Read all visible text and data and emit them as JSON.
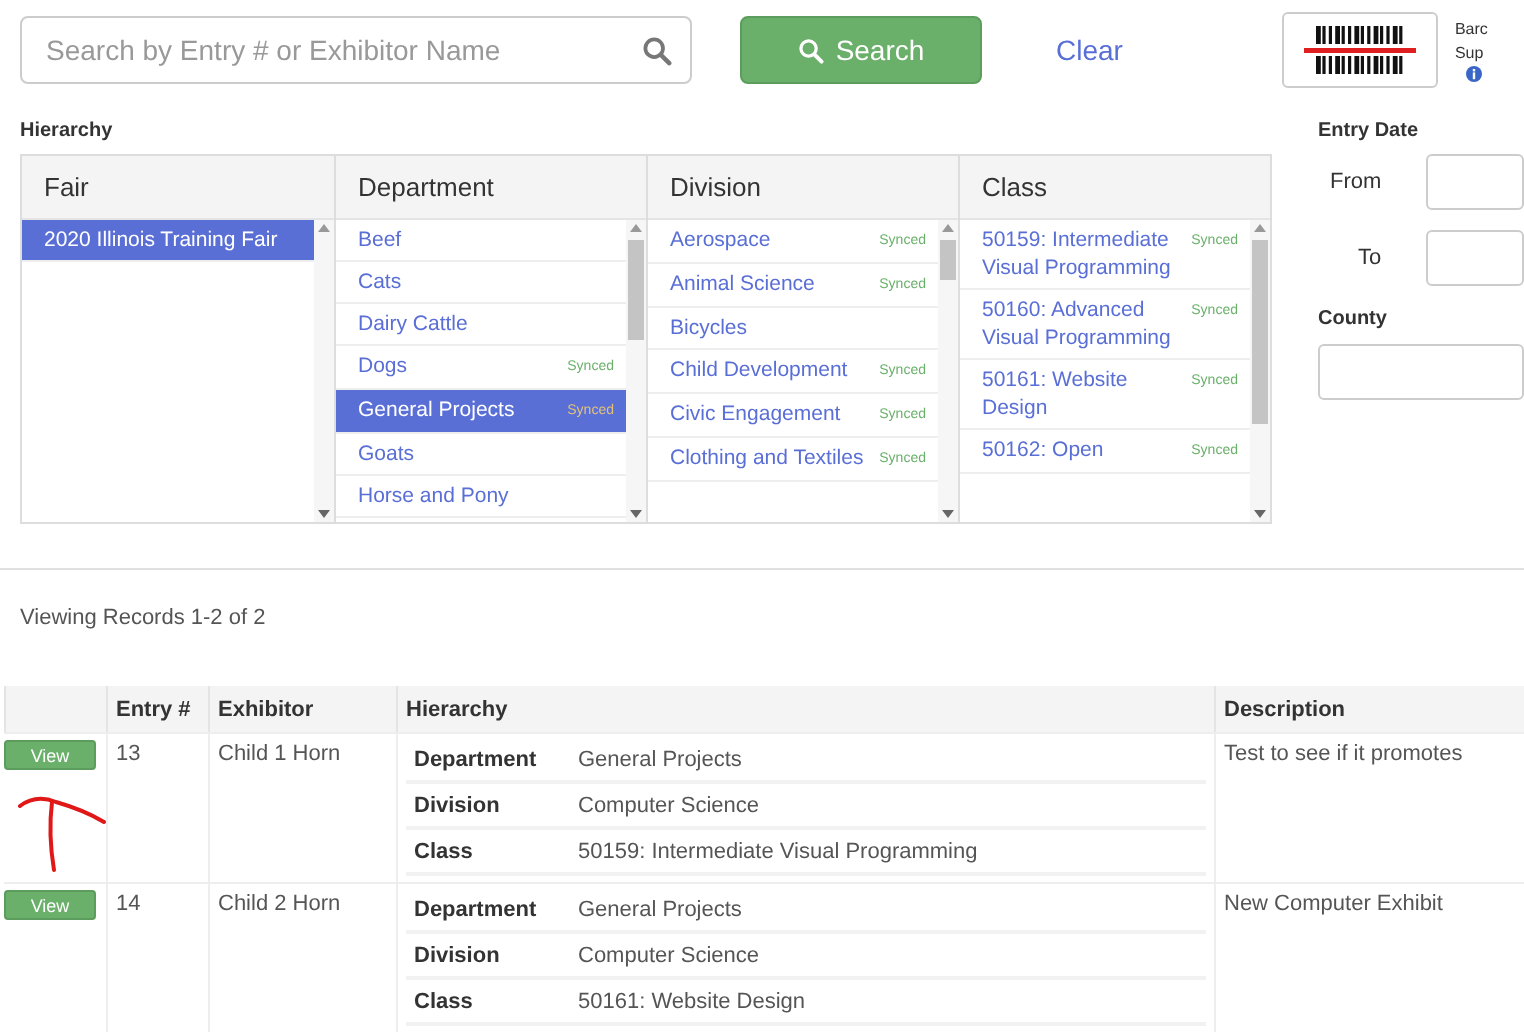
{
  "search": {
    "placeholder": "Search by Entry # or Exhibitor Name",
    "button": "Search",
    "clear": "Clear"
  },
  "barcode": {
    "lines": [
      "Barc",
      "Sup"
    ]
  },
  "hierarchy": {
    "label": "Hierarchy",
    "columns": [
      {
        "title": "Fair",
        "items": [
          {
            "label": "2020 Illinois Training Fair",
            "selected": true
          }
        ]
      },
      {
        "title": "Department",
        "items": [
          {
            "label": "Beef",
            "selected": false
          },
          {
            "label": "Cats",
            "selected": false
          },
          {
            "label": "Dairy Cattle",
            "selected": false
          },
          {
            "label": "Dogs",
            "badge": "Synced",
            "selected": false
          },
          {
            "label": "General Projects",
            "badge": "Synced",
            "selected": true
          },
          {
            "label": "Goats",
            "selected": false
          },
          {
            "label": "Horse and Pony",
            "selected": false
          }
        ]
      },
      {
        "title": "Division",
        "items": [
          {
            "label": "Aerospace",
            "badge": "Synced",
            "selected": false
          },
          {
            "label": "Animal Science",
            "badge": "Synced",
            "selected": false
          },
          {
            "label": "Bicycles",
            "selected": false
          },
          {
            "label": "Child Development",
            "badge": "Synced",
            "selected": false
          },
          {
            "label": "Civic Engagement",
            "badge": "Synced",
            "selected": false
          },
          {
            "label": "Clothing and Textiles",
            "badge": "Synced",
            "selected": false
          }
        ]
      },
      {
        "title": "Class",
        "items": [
          {
            "label": "50159: Intermediate Visual Programming",
            "badge": "Synced",
            "selected": false
          },
          {
            "label": "50160: Advanced Visual Programming",
            "badge": "Synced",
            "selected": false
          },
          {
            "label": "50161: Website Design",
            "badge": "Synced",
            "selected": false
          },
          {
            "label": "50162: Open",
            "badge": "Synced",
            "selected": false
          }
        ]
      }
    ]
  },
  "filters": {
    "entry_date": "Entry Date",
    "from": "From",
    "to": "To",
    "county": "County"
  },
  "records": {
    "summary": "Viewing Records 1-2 of 2",
    "columns": [
      "Entry #",
      "Exhibitor",
      "Hierarchy",
      "Description"
    ],
    "rows": [
      {
        "button": "View",
        "entry": "13",
        "exhibitor": "Child 1 Horn",
        "hierarchy": [
          {
            "label": "Department",
            "value": "General Projects"
          },
          {
            "label": "Division",
            "value": "Computer Science"
          },
          {
            "label": "Class",
            "value": "50159: Intermediate Visual Programming"
          }
        ],
        "description": "Test to see if it promotes"
      },
      {
        "button": "View",
        "entry": "14",
        "exhibitor": "Child 2 Horn",
        "hierarchy": [
          {
            "label": "Department",
            "value": "General Projects"
          },
          {
            "label": "Division",
            "value": "Computer Science"
          },
          {
            "label": "Class",
            "value": "50161: Website Design"
          }
        ],
        "description": "New Computer Exhibit"
      }
    ]
  }
}
